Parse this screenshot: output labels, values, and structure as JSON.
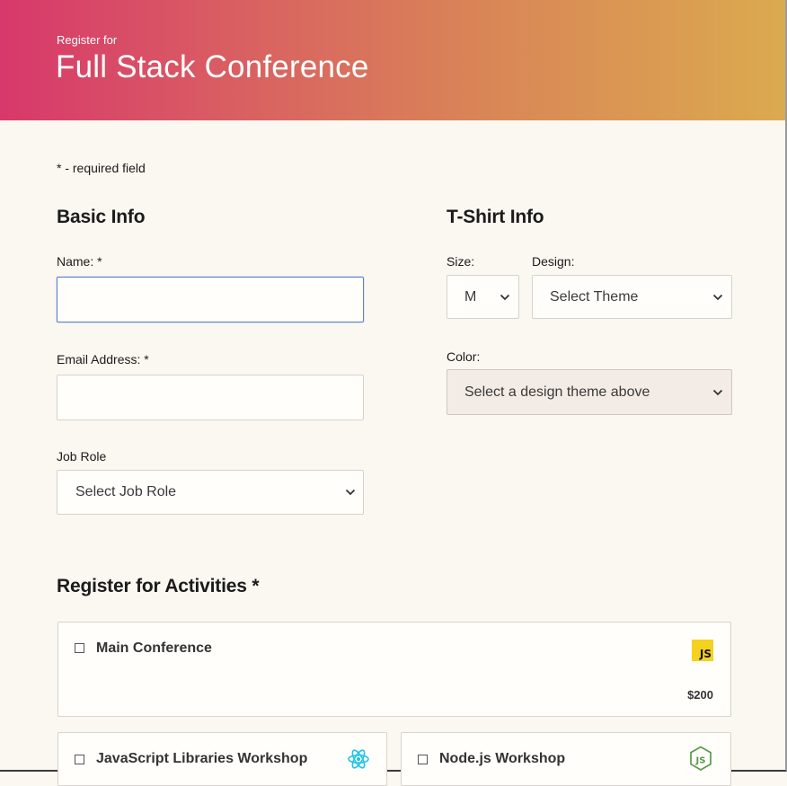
{
  "header": {
    "subtitle": "Register for",
    "title": "Full Stack Conference"
  },
  "required_note": "* - required field",
  "basic_info": {
    "title": "Basic Info",
    "name_label": "Name: *",
    "name_value": "",
    "email_label": "Email Address: *",
    "email_value": "",
    "job_role_label": "Job Role",
    "job_role_selected": "Select Job Role"
  },
  "tshirt_info": {
    "title": "T-Shirt Info",
    "size_label": "Size:",
    "size_selected": "M",
    "design_label": "Design:",
    "design_selected": "Select Theme",
    "color_label": "Color:",
    "color_selected": "Select a design theme above"
  },
  "activities": {
    "title": "Register for Activities *",
    "items": [
      {
        "name": "Main Conference",
        "price": "$200",
        "icon": "javascript-icon",
        "checked": false
      },
      {
        "name": "JavaScript Libraries Workshop",
        "icon": "react-icon",
        "checked": false
      },
      {
        "name": "Node.js Workshop",
        "icon": "nodejs-icon",
        "checked": false
      }
    ]
  },
  "colors": {
    "header_start": "#d8386b",
    "header_end": "#dbaa4f",
    "background": "#fbf7f1",
    "focus_border": "#5b7fd4",
    "js_yellow": "#f5d21d",
    "react_cyan": "#1fc4e8",
    "node_green": "#5a9a4c"
  }
}
